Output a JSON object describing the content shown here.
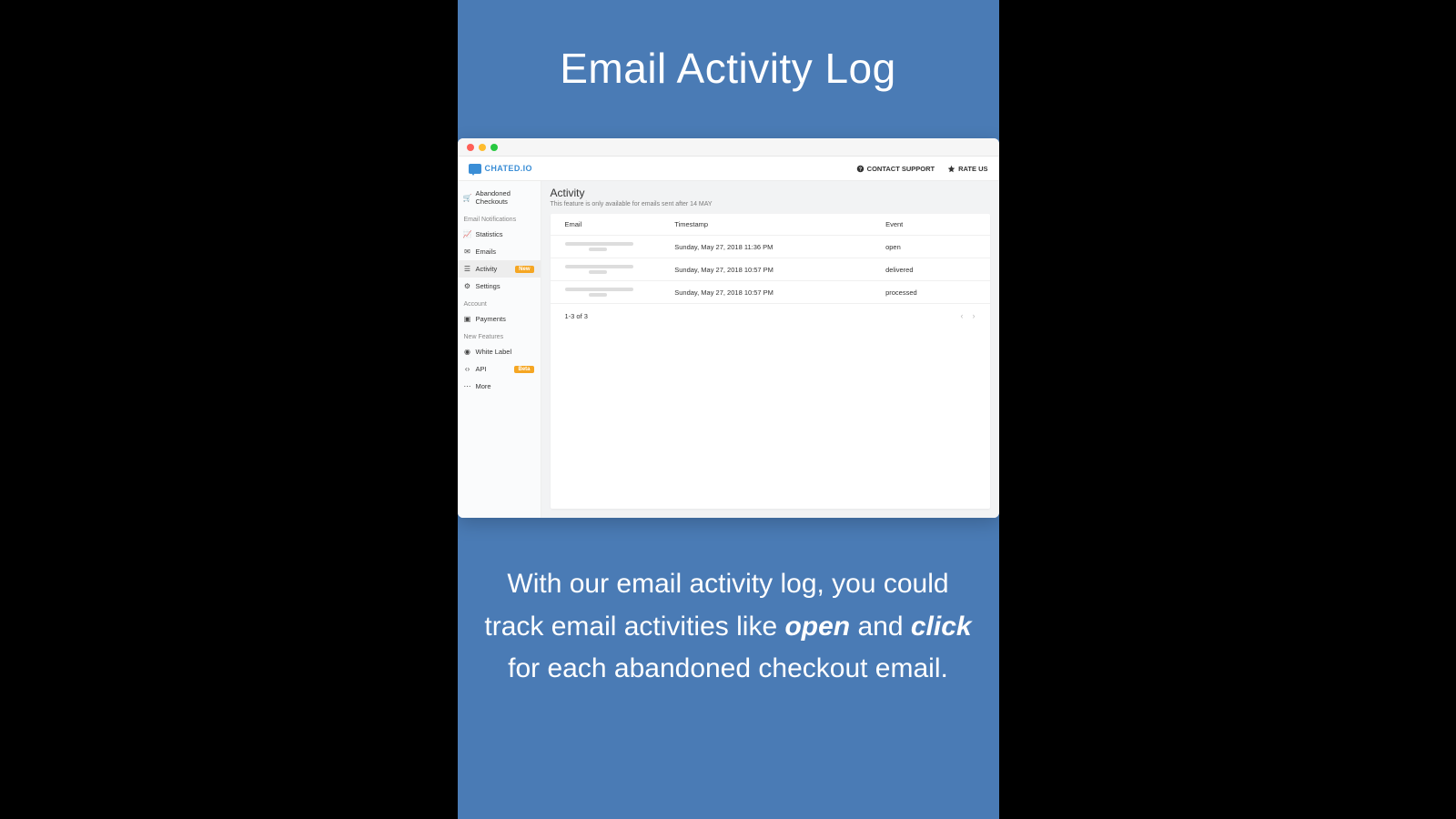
{
  "promo": {
    "title": "Email Activity Log",
    "desc_pre": "With our email activity log, you could track email activities like ",
    "desc_em1": "open",
    "desc_mid": " and ",
    "desc_em2": "click",
    "desc_post": " for each abandoned checkout email."
  },
  "header": {
    "brand": "CHATED.IO",
    "contact": "CONTACT SUPPORT",
    "rate": "RATE US"
  },
  "sidebar": {
    "top": {
      "label": "Abandoned Checkouts"
    },
    "sections": {
      "notifications": "Email Notifications",
      "account": "Account",
      "new_features": "New Features"
    },
    "items": {
      "statistics": "Statistics",
      "emails": "Emails",
      "activity": "Activity",
      "settings": "Settings",
      "payments": "Payments",
      "white_label": "White Label",
      "api": "API",
      "more": "More"
    },
    "badges": {
      "new": "New",
      "beta": "Beta"
    }
  },
  "main": {
    "title": "Activity",
    "subtitle": "This feature is only available for emails sent after 14 MAY",
    "columns": {
      "email": "Email",
      "timestamp": "Timestamp",
      "event": "Event"
    },
    "rows": [
      {
        "timestamp": "Sunday, May 27, 2018 11:36 PM",
        "event": "open"
      },
      {
        "timestamp": "Sunday, May 27, 2018 10:57 PM",
        "event": "delivered"
      },
      {
        "timestamp": "Sunday, May 27, 2018 10:57 PM",
        "event": "processed"
      }
    ],
    "pager": "1-3 of 3"
  }
}
